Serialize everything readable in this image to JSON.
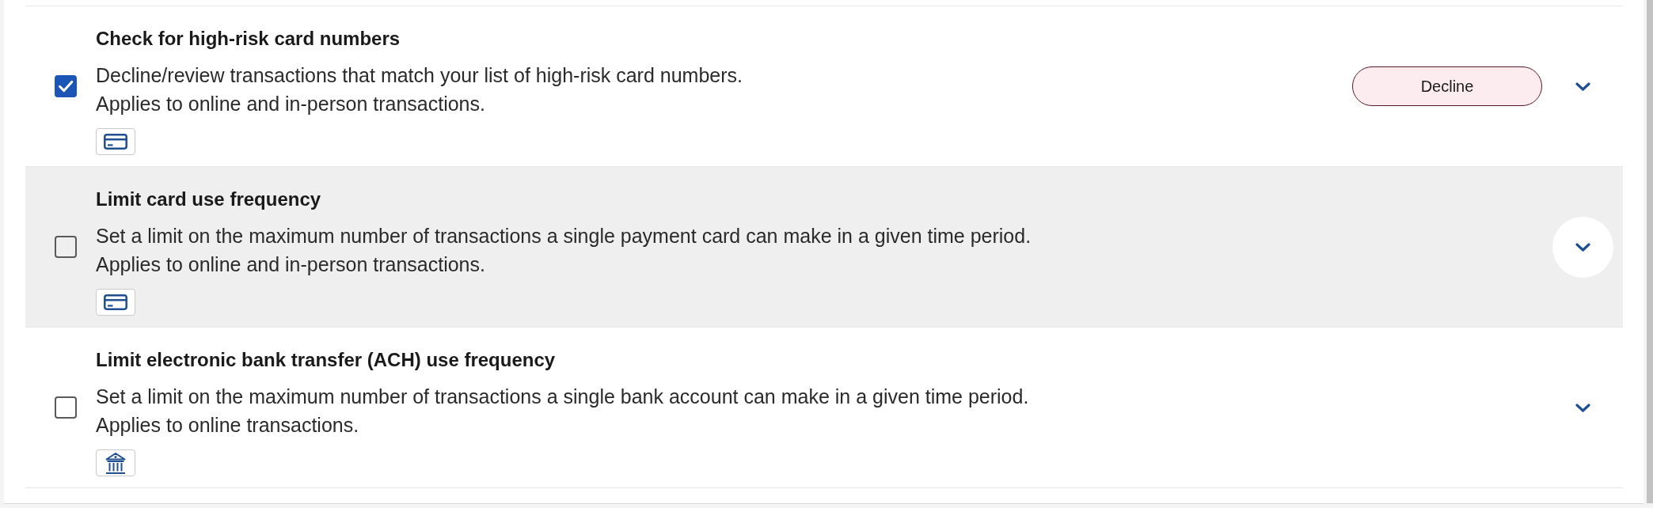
{
  "rules": [
    {
      "kind": "card",
      "title": "Check for high-risk card numbers",
      "description": "Decline/review transactions that match your list of high-risk card numbers.",
      "scope": "Applies to online and in-person transactions.",
      "checked": true,
      "action": {
        "label": "Decline"
      },
      "hovered": false,
      "expanded": false
    },
    {
      "kind": "card",
      "title": "Limit card use frequency",
      "description": "Set a limit on the maximum number of transactions a single payment card can make in a given time period.",
      "scope": "Applies to online and in-person transactions.",
      "checked": false,
      "hovered": true,
      "expanded": false
    },
    {
      "kind": "bank",
      "title": "Limit electronic bank transfer (ACH) use frequency",
      "description": "Set a limit on the maximum number of transactions a single bank account can make in a given time period.",
      "scope": "Applies to online transactions.",
      "checked": false,
      "hovered": false,
      "expanded": false
    }
  ]
}
